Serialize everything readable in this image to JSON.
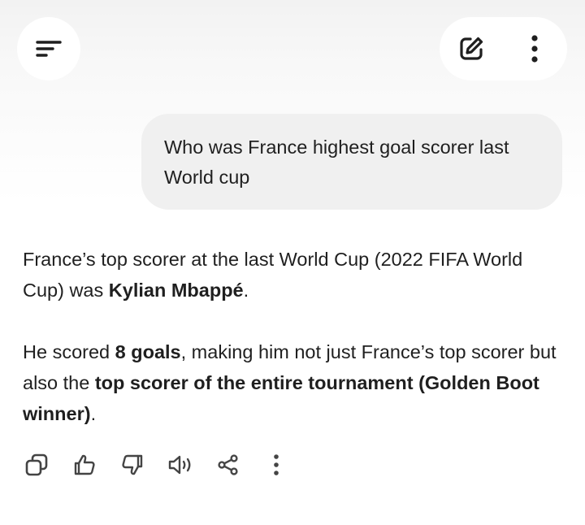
{
  "header": {
    "menu_icon": "menu-icon",
    "new_chat_icon": "edit-icon",
    "more_icon": "more-vertical-icon"
  },
  "conversation": {
    "user_message": "Who was France highest goal scorer last World cup",
    "response": {
      "p1_a": "France’s top scorer at the last World Cup (2022 FIFA World Cup) was ",
      "p1_b": "Kylian Mbappé",
      "p1_c": ".",
      "p2_a": "He scored ",
      "p2_b": "8 goals",
      "p2_c": ", making him not just France’s top scorer but also the ",
      "p2_d": "top scorer of the entire tournament (Golden Boot winner)",
      "p2_e": "."
    }
  },
  "actions": {
    "icons": [
      "copy-icon",
      "thumbs-up-icon",
      "thumbs-down-icon",
      "read-aloud-icon",
      "share-icon",
      "more-vertical-icon"
    ]
  }
}
